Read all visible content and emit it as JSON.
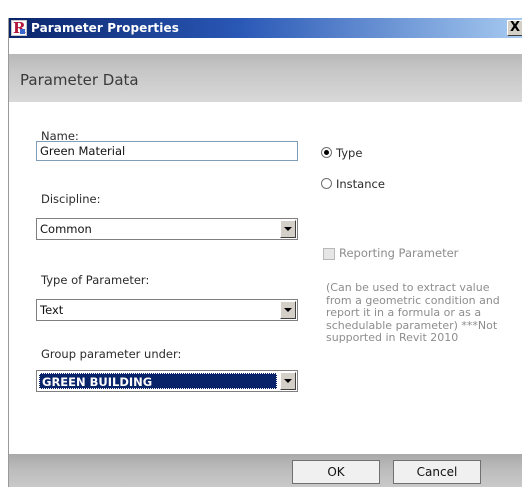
{
  "window": {
    "title": "Parameter Properties",
    "close_symbol": "X",
    "app_icon_glyph": "R"
  },
  "header": {
    "title": "Parameter Data"
  },
  "form": {
    "name_label": "Name:",
    "name_value": "Green Material",
    "discipline_label": "Discipline:",
    "discipline_value": "Common",
    "type_label": "Type of Parameter:",
    "type_value": "Text",
    "group_label": "Group parameter under:",
    "group_value": "GREEN BUILDING"
  },
  "options": {
    "type_label": "Type",
    "instance_label": "Instance",
    "selected": "Type"
  },
  "reporting": {
    "label": "Reporting Parameter",
    "checked": false,
    "enabled": false,
    "note": "(Can be used to extract value from a geometric condition and report it in a formula or as a schedulable parameter) ***Not supported in Revit 2010"
  },
  "footer": {
    "ok_label": "OK",
    "cancel_label": "Cancel"
  },
  "colors": {
    "title_bar_start": "#0a246a",
    "title_bar_end": "#a6caf0",
    "selection": "#0a246a",
    "header_band": "#c7c7c7"
  }
}
